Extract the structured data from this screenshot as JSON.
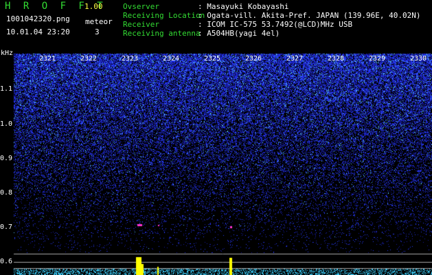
{
  "header": {
    "brand": "H R O F F T",
    "version": "1.00",
    "filename": "1001042320.png",
    "datetime": "10.01.04 23:20",
    "meteor_label": "meteor",
    "meteor_count": "3"
  },
  "info": [
    {
      "key": "Ovserver",
      "value": ": Masayuki Kobayashi"
    },
    {
      "key": "Receiving Location",
      "value": ": Ogata-vill. Akita-Pref. JAPAN (139.96E, 40.02N)"
    },
    {
      "key": "Receiver",
      "value": ": ICOM IC-575 53.7492(@LCD)MHz USB"
    },
    {
      "key": "Receiving antenna",
      "value": ": A504HB(yagi 4el)"
    }
  ],
  "axis": {
    "unit": "kHz",
    "y_labels": [
      "1.1",
      "1.0",
      "0.9",
      "0.8",
      "0.7",
      "0.6"
    ],
    "time_labels": [
      "2321",
      "2322",
      "2323",
      "2324",
      "2325",
      "2326",
      "2327",
      "2328",
      "2329",
      "2330"
    ]
  },
  "colors": {
    "header_green": "#33dd33",
    "header_white": "#ffffff",
    "header_yellow": "#ffff44",
    "noise_blue": "#2b3cff",
    "noise_cyan": "#55ccff",
    "trace_yellow": "#ffff00",
    "event_magenta": "#ff33cc"
  }
}
